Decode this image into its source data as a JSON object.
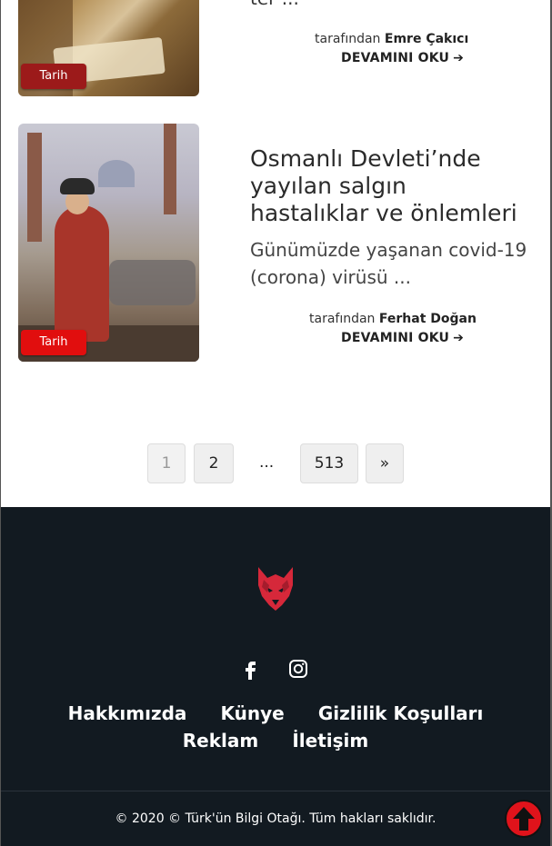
{
  "previous_post": {
    "truncated_excerpt": "ter ...",
    "category": "Tarih",
    "author_prefix": "tarafından",
    "author": "Emre Çakıcı",
    "read_more": "DEVAMINI OKU",
    "read_more_icon": "arrow-right-icon"
  },
  "post": {
    "title": "Osmanlı Devleti’nde yayılan salgın hastalıklar ve önlemleri",
    "excerpt": "Günümüzde yaşanan covid-19 (corona) virüsü ...",
    "category": "Tarih",
    "author_prefix": "tarafından",
    "author": "Ferhat Doğan",
    "read_more": "DEVAMINI OKU",
    "read_more_icon": "arrow-right-icon"
  },
  "pagination": {
    "current": "1",
    "page2": "2",
    "dots": "...",
    "last": "513",
    "next": "»"
  },
  "footer": {
    "logo_icon": "wolf-head-logo",
    "social": [
      "facebook-icon",
      "instagram-icon"
    ],
    "links": [
      "Hakkımızda",
      "Künye",
      "Gizlilik Koşulları",
      "Reklam",
      "İletişim"
    ],
    "copyright": "© 2020 © Türk'ün Bilgi Otağı. Tüm hakları saklıdır.",
    "back_to_top_icon": "arrow-up-circle-icon"
  },
  "colors": {
    "footer_bg": "#121a21",
    "badge_dark": "#9c1a1a",
    "badge_bright": "#e10e0e",
    "accent_red": "#e0131b"
  }
}
